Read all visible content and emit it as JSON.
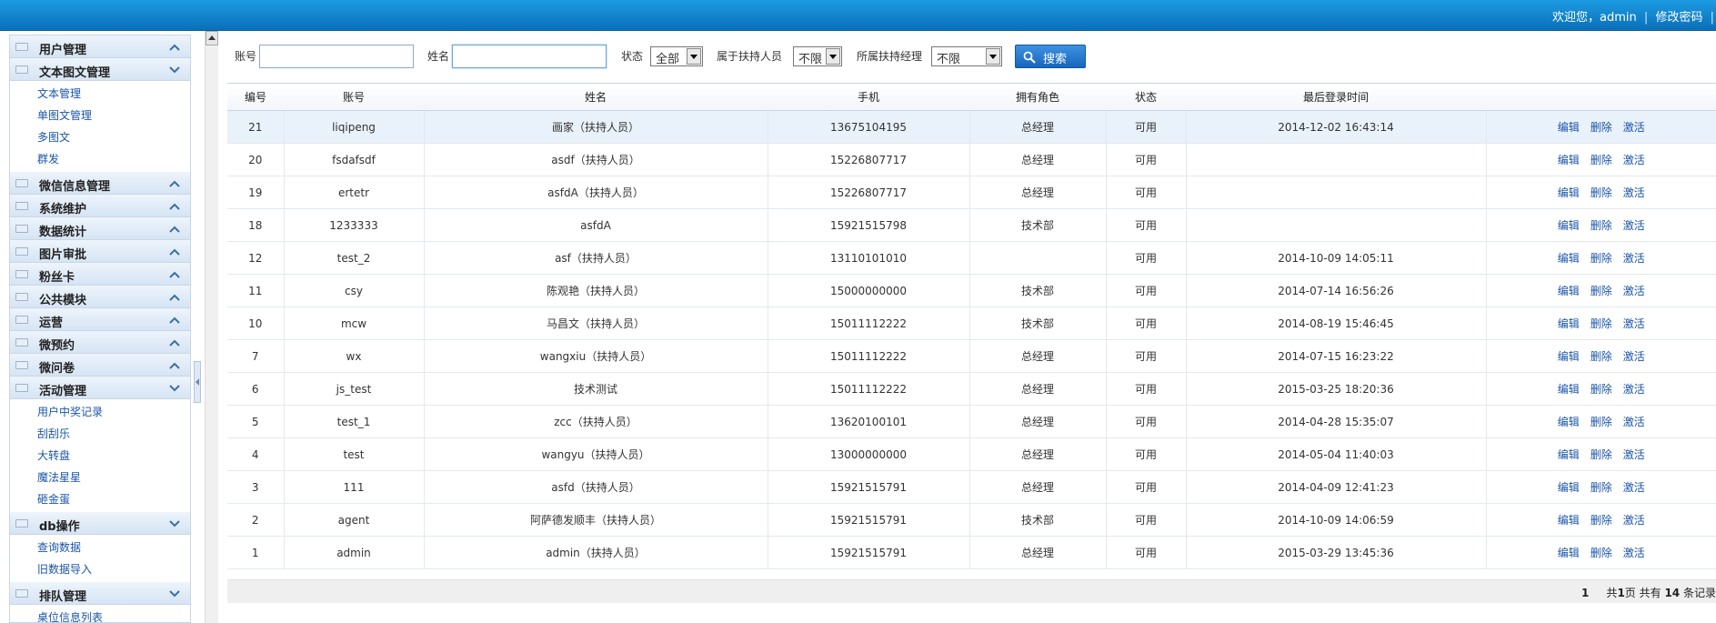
{
  "header": {
    "welcome": "欢迎您，admin",
    "separator": "|",
    "change_password": "修改密码",
    "extra": "|"
  },
  "sidebar": {
    "groups": [
      {
        "label": "用户管理",
        "state": "collapsed",
        "items": []
      },
      {
        "label": "文本图文管理",
        "state": "expanded",
        "items": [
          "文本管理",
          "单图文管理",
          "多图文",
          "群发"
        ]
      },
      {
        "label": "微信信息管理",
        "state": "collapsed",
        "items": []
      },
      {
        "label": "系统维护",
        "state": "collapsed",
        "items": []
      },
      {
        "label": "数据统计",
        "state": "collapsed",
        "items": []
      },
      {
        "label": "图片审批",
        "state": "collapsed",
        "items": []
      },
      {
        "label": "粉丝卡",
        "state": "collapsed",
        "items": []
      },
      {
        "label": "公共模块",
        "state": "collapsed",
        "items": []
      },
      {
        "label": "运营",
        "state": "collapsed",
        "items": []
      },
      {
        "label": "微预约",
        "state": "collapsed",
        "items": []
      },
      {
        "label": "微问卷",
        "state": "collapsed",
        "items": []
      },
      {
        "label": "活动管理",
        "state": "expanded",
        "items": [
          "用户中奖记录",
          "刮刮乐",
          "大转盘",
          "魔法星星",
          "砸金蛋"
        ]
      },
      {
        "label": "db操作",
        "state": "expanded",
        "items": [
          "查询数据",
          "旧数据导入"
        ]
      },
      {
        "label": "排队管理",
        "state": "expanded",
        "items": [
          "桌位信息列表"
        ]
      }
    ]
  },
  "search": {
    "account_label": "账号",
    "account_value": "",
    "name_label": "姓名",
    "name_value": "",
    "status_label": "状态",
    "status_value": "全部",
    "belongs_label": "属于扶持人员",
    "belongs_value": "不限",
    "manager_label": "所属扶持经理",
    "manager_value": "不限",
    "search_button": "搜索"
  },
  "table": {
    "columns": [
      "编号",
      "账号",
      "姓名",
      "手机",
      "拥有角色",
      "状态",
      "最后登录时间",
      ""
    ],
    "action_labels": {
      "edit": "编辑",
      "delete": "删除",
      "activate": "激活"
    },
    "rows": [
      {
        "id": "21",
        "account": "liqipeng",
        "name": "画家（扶持人员）",
        "phone": "13675104195",
        "role": "总经理",
        "status": "可用",
        "last_login": "2014-12-02 16:43:14"
      },
      {
        "id": "20",
        "account": "fsdafsdf",
        "name": "asdf（扶持人员）",
        "phone": "15226807717",
        "role": "总经理",
        "status": "可用",
        "last_login": ""
      },
      {
        "id": "19",
        "account": "ertetr",
        "name": "asfdA（扶持人员）",
        "phone": "15226807717",
        "role": "总经理",
        "status": "可用",
        "last_login": ""
      },
      {
        "id": "18",
        "account": "1233333",
        "name": "asfdA",
        "phone": "15921515798",
        "role": "技术部",
        "status": "可用",
        "last_login": ""
      },
      {
        "id": "12",
        "account": "test_2",
        "name": "asf（扶持人员）",
        "phone": "13110101010",
        "role": "",
        "status": "可用",
        "last_login": "2014-10-09 14:05:11"
      },
      {
        "id": "11",
        "account": "csy",
        "name": "陈观艳（扶持人员）",
        "phone": "15000000000",
        "role": "技术部",
        "status": "可用",
        "last_login": "2014-07-14 16:56:26"
      },
      {
        "id": "10",
        "account": "mcw",
        "name": "马昌文（扶持人员）",
        "phone": "15011112222",
        "role": "技术部",
        "status": "可用",
        "last_login": "2014-08-19 15:46:45"
      },
      {
        "id": "7",
        "account": "wx",
        "name": "wangxiu（扶持人员）",
        "phone": "15011112222",
        "role": "总经理",
        "status": "可用",
        "last_login": "2014-07-15 16:23:22"
      },
      {
        "id": "6",
        "account": "js_test",
        "name": "技术测试",
        "phone": "15011112222",
        "role": "总经理",
        "status": "可用",
        "last_login": "2015-03-25 18:20:36"
      },
      {
        "id": "5",
        "account": "test_1",
        "name": "zcc（扶持人员）",
        "phone": "13620100101",
        "role": "总经理",
        "status": "可用",
        "last_login": "2014-04-28 15:35:07"
      },
      {
        "id": "4",
        "account": "test",
        "name": "wangyu（扶持人员）",
        "phone": "13000000000",
        "role": "总经理",
        "status": "可用",
        "last_login": "2014-05-04 11:40:03"
      },
      {
        "id": "3",
        "account": "111",
        "name": "asfd（扶持人员）",
        "phone": "15921515791",
        "role": "总经理",
        "status": "可用",
        "last_login": "2014-04-09 12:41:23"
      },
      {
        "id": "2",
        "account": "agent",
        "name": "阿萨德发顺丰（扶持人员）",
        "phone": "15921515791",
        "role": "技术部",
        "status": "可用",
        "last_login": "2014-10-09 14:06:59"
      },
      {
        "id": "1",
        "account": "admin",
        "name": "admin（扶持人员）",
        "phone": "15921515791",
        "role": "总经理",
        "status": "可用",
        "last_login": "2015-03-29 13:45:36"
      }
    ]
  },
  "pager": {
    "current_page": "1",
    "summary_prefix": "共",
    "total_pages": "1",
    "pages_suffix": "页 共有",
    "total_records": "14",
    "records_suffix": "条记录"
  }
}
